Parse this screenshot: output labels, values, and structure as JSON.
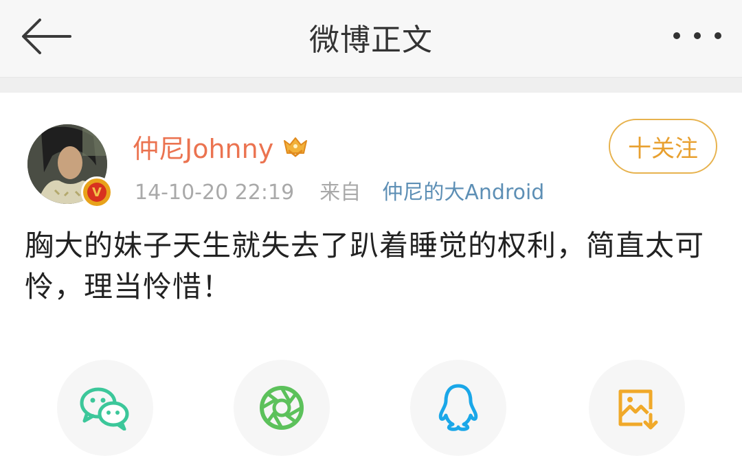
{
  "header": {
    "title": "微博正文"
  },
  "post": {
    "author": "仲尼Johnny",
    "timestamp": "14-10-20 22:19",
    "source_prefix": "来自",
    "source": "仲尼的大Android",
    "follow_label": "十关注",
    "content": "胸大的妹子天生就失去了趴着睡觉的权利，简直太可怜，理当怜惜！"
  },
  "share": {
    "items": [
      "wechat-icon",
      "moments-icon",
      "qq-icon",
      "save-image-icon"
    ]
  },
  "colors": {
    "username": "#eb7350",
    "source": "#5d8fb5",
    "follow": "#e8a02f",
    "wechat": "#3cc79a",
    "moments": "#5cc15b",
    "qq": "#1aa7e8",
    "save": "#f0a92a"
  }
}
